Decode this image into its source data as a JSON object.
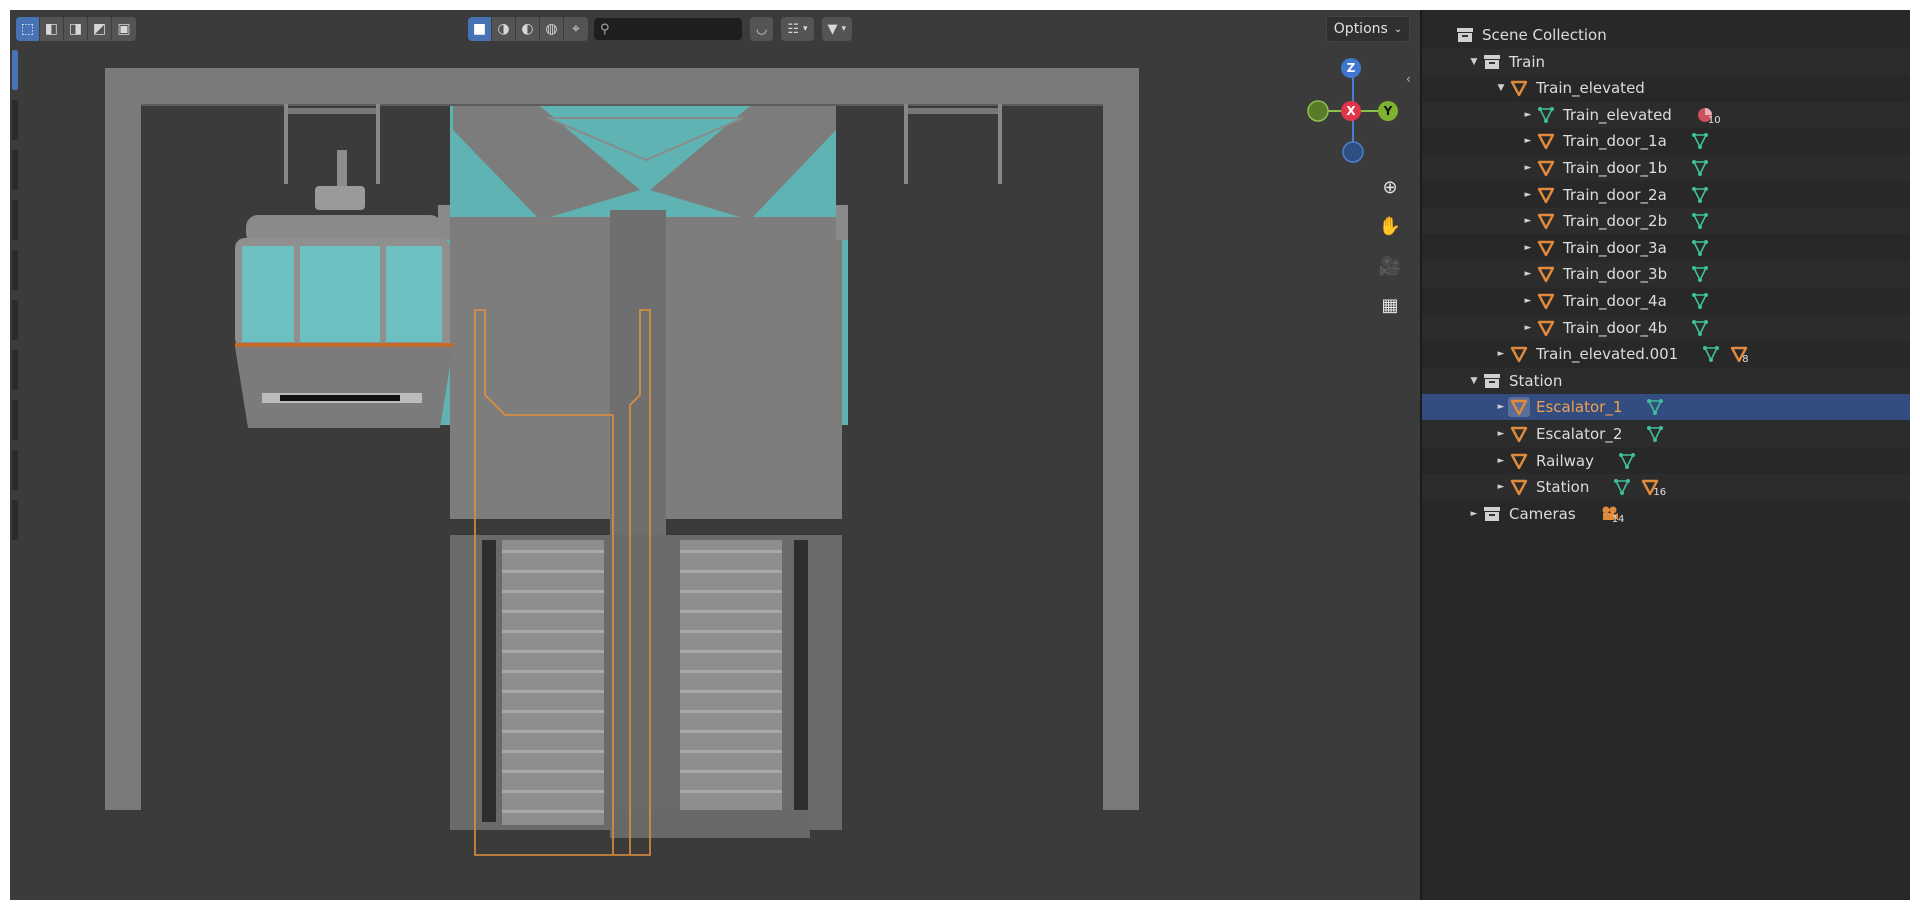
{
  "toolbar": {
    "select_modes": [
      "select-box-icon",
      "select-extend-icon",
      "select-subtract-icon",
      "select-invert-icon",
      "select-intersect-icon"
    ],
    "view_modes": [
      "solid-shading-icon",
      "material-shading-icon",
      "rendered-shading-icon",
      "world-icon",
      "cursor-icon"
    ],
    "search_placeholder": "",
    "options_label": "Options"
  },
  "gizmo": {
    "z": "Z",
    "x": "X",
    "y": "Y"
  },
  "outliner": {
    "rows": [
      {
        "label": "Scene Collection",
        "indent": 0,
        "icon": "scene-collection-icon",
        "tri": ""
      },
      {
        "label": "Train",
        "indent": 1,
        "icon": "collection-icon",
        "tri": "▼"
      },
      {
        "label": "Train_elevated",
        "indent": 2,
        "icon": "object-orange-icon",
        "tri": "▼"
      },
      {
        "label": "Train_elevated",
        "indent": 3,
        "icon": "mesh-green-icon",
        "tri": "►",
        "badge": "material-icon",
        "badge_num": "10"
      },
      {
        "label": "Train_door_1a",
        "indent": 3,
        "icon": "object-orange-icon",
        "tri": "►",
        "badge": "mesh-green-icon"
      },
      {
        "label": "Train_door_1b",
        "indent": 3,
        "icon": "object-orange-icon",
        "tri": "►",
        "badge": "mesh-green-icon"
      },
      {
        "label": "Train_door_2a",
        "indent": 3,
        "icon": "object-orange-icon",
        "tri": "►",
        "badge": "mesh-green-icon"
      },
      {
        "label": "Train_door_2b",
        "indent": 3,
        "icon": "object-orange-icon",
        "tri": "►",
        "badge": "mesh-green-icon"
      },
      {
        "label": "Train_door_3a",
        "indent": 3,
        "icon": "object-orange-icon",
        "tri": "►",
        "badge": "mesh-green-icon"
      },
      {
        "label": "Train_door_3b",
        "indent": 3,
        "icon": "object-orange-icon",
        "tri": "►",
        "badge": "mesh-green-icon"
      },
      {
        "label": "Train_door_4a",
        "indent": 3,
        "icon": "object-orange-icon",
        "tri": "►",
        "badge": "mesh-green-icon"
      },
      {
        "label": "Train_door_4b",
        "indent": 3,
        "icon": "object-orange-icon",
        "tri": "►",
        "badge": "mesh-green-icon"
      },
      {
        "label": "Train_elevated.001",
        "indent": 2,
        "icon": "object-orange-icon",
        "tri": "►",
        "badge": "mesh-green-icon",
        "badge2": "object-orange-icon",
        "badge2_num": "8"
      },
      {
        "label": "Station",
        "indent": 1,
        "icon": "collection-icon",
        "tri": "▼"
      },
      {
        "label": "Escalator_1",
        "indent": 2,
        "icon": "object-orange-icon",
        "tri": "►",
        "badge": "mesh-green-icon",
        "selected": true
      },
      {
        "label": "Escalator_2",
        "indent": 2,
        "icon": "object-orange-icon",
        "tri": "►",
        "badge": "mesh-green-icon"
      },
      {
        "label": "Railway",
        "indent": 2,
        "icon": "object-orange-icon",
        "tri": "►",
        "badge": "mesh-green-icon"
      },
      {
        "label": "Station",
        "indent": 2,
        "icon": "object-orange-icon",
        "tri": "►",
        "badge": "mesh-green-icon",
        "badge2": "object-orange-icon",
        "badge2_num": "16"
      },
      {
        "label": "Cameras",
        "indent": 1,
        "icon": "collection-icon",
        "tri": "►",
        "badge": "camera-icon",
        "badge_num": "14"
      }
    ]
  },
  "colors": {
    "selected_row": "#334d80",
    "object_orange": "#e08a3c",
    "mesh_green": "#3fbf9a",
    "accent_blue": "#4772b3"
  }
}
